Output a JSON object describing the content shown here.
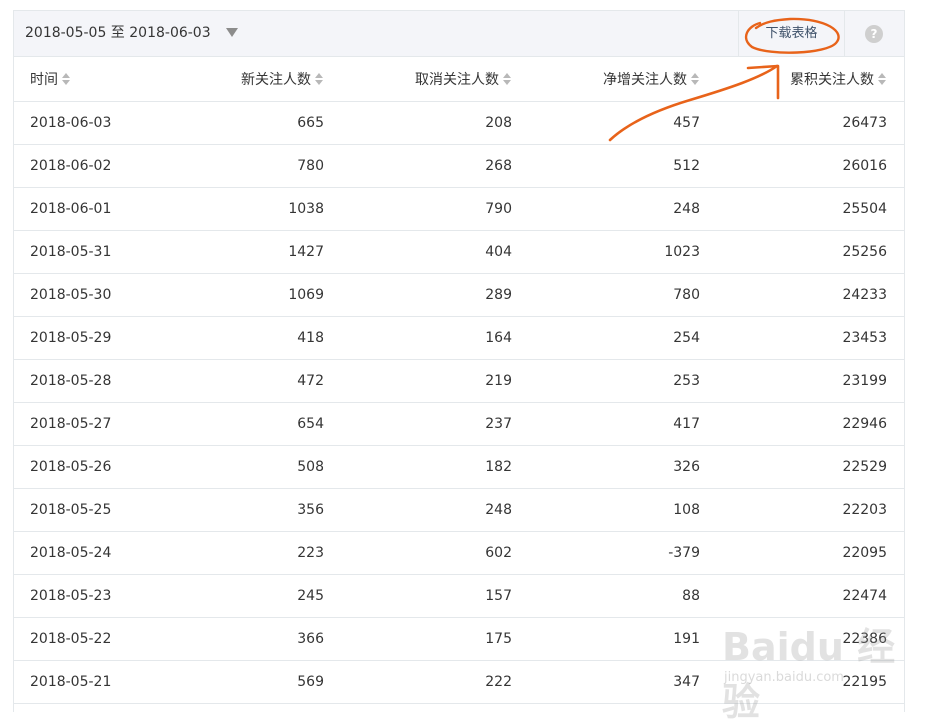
{
  "toolbar": {
    "date_range": "2018-05-05 至 2018-06-03",
    "download_label": "下载表格",
    "help_glyph": "?"
  },
  "table": {
    "columns": [
      "时间",
      "新关注人数",
      "取消关注人数",
      "净增关注人数",
      "累积关注人数"
    ],
    "rows": [
      [
        "2018-06-03",
        "665",
        "208",
        "457",
        "26473"
      ],
      [
        "2018-06-02",
        "780",
        "268",
        "512",
        "26016"
      ],
      [
        "2018-06-01",
        "1038",
        "790",
        "248",
        "25504"
      ],
      [
        "2018-05-31",
        "1427",
        "404",
        "1023",
        "25256"
      ],
      [
        "2018-05-30",
        "1069",
        "289",
        "780",
        "24233"
      ],
      [
        "2018-05-29",
        "418",
        "164",
        "254",
        "23453"
      ],
      [
        "2018-05-28",
        "472",
        "219",
        "253",
        "23199"
      ],
      [
        "2018-05-27",
        "654",
        "237",
        "417",
        "22946"
      ],
      [
        "2018-05-26",
        "508",
        "182",
        "326",
        "22529"
      ],
      [
        "2018-05-25",
        "356",
        "248",
        "108",
        "22203"
      ],
      [
        "2018-05-24",
        "223",
        "602",
        "-379",
        "22095"
      ],
      [
        "2018-05-23",
        "245",
        "157",
        "88",
        "22474"
      ],
      [
        "2018-05-22",
        "366",
        "175",
        "191",
        "22386"
      ],
      [
        "2018-05-21",
        "569",
        "222",
        "347",
        "22195"
      ]
    ]
  },
  "watermark": {
    "main": "Baidu 经验",
    "sub": "jingyan.baidu.com"
  },
  "colors": {
    "annotation": "#e8631a",
    "toolbar_bg": "#f4f5f9",
    "border": "#e4e8eb"
  }
}
